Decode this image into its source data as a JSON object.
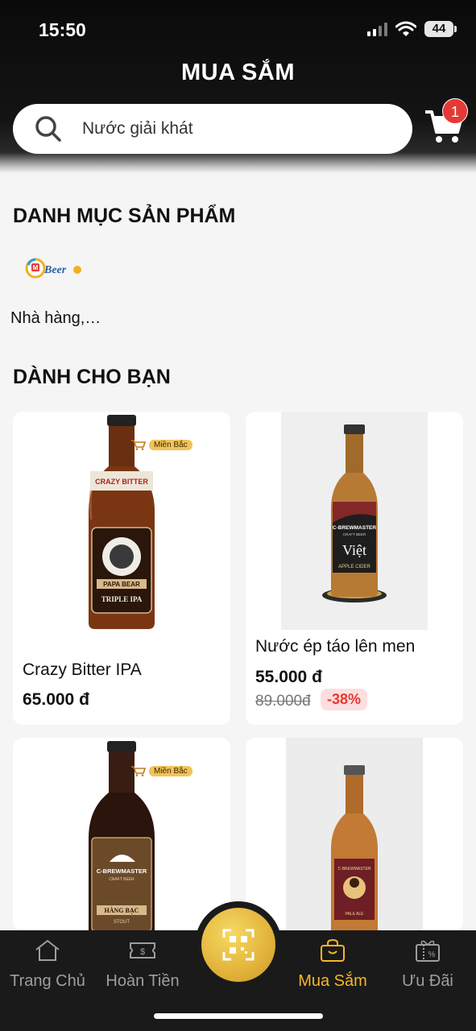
{
  "status_bar": {
    "time": "15:50",
    "battery": "44"
  },
  "header": {
    "title": "MUA SẮM",
    "search_placeholder": "Nước giải khát",
    "cart_count": "1"
  },
  "categories_section": {
    "title": "DANH MỤC SẢN PHẨM",
    "brand_logo_text": "MBeer",
    "items": [
      {
        "label": "Nhà hàng,…"
      }
    ]
  },
  "recommended_section": {
    "title": "DÀNH CHO BẠN",
    "products": [
      {
        "name": "Crazy Bitter IPA",
        "price": "65.000 đ",
        "region": "Miền Bắc",
        "bottle_labels": [
          "CRAZY BITTER",
          "PAPA BEAR",
          "TRIPLE IPA"
        ]
      },
      {
        "name": "Nước ép táo lên men",
        "price": "55.000 đ",
        "old_price": "89.000đ",
        "discount": "-38%",
        "bottle_labels": [
          "C-BREWMASTER",
          "CRAFT BEER",
          "Việt",
          "APPLE CIDER"
        ]
      },
      {
        "name": "",
        "region": "Miền Bắc",
        "bottle_labels": [
          "C-BREWMASTER",
          "CRAFT BEER",
          "HÀNG BẠC",
          "STOUT"
        ]
      },
      {
        "name": "",
        "bottle_labels": [
          "C-BREWMASTER",
          "PALE ALE"
        ]
      }
    ]
  },
  "tab_bar": {
    "tabs": [
      {
        "label": "Trang Chủ",
        "icon": "home-icon"
      },
      {
        "label": "Hoàn Tiền",
        "icon": "ticket-icon"
      },
      {
        "label": "Mua Sắm",
        "icon": "shopping-bag-icon",
        "active": true
      },
      {
        "label": "Ưu Đãi",
        "icon": "gift-percent-icon"
      }
    ],
    "center_button_icon": "qr-scan-icon"
  },
  "colors": {
    "accent": "#f5b825",
    "header_bg": "#111111",
    "badge": "#e53935"
  }
}
